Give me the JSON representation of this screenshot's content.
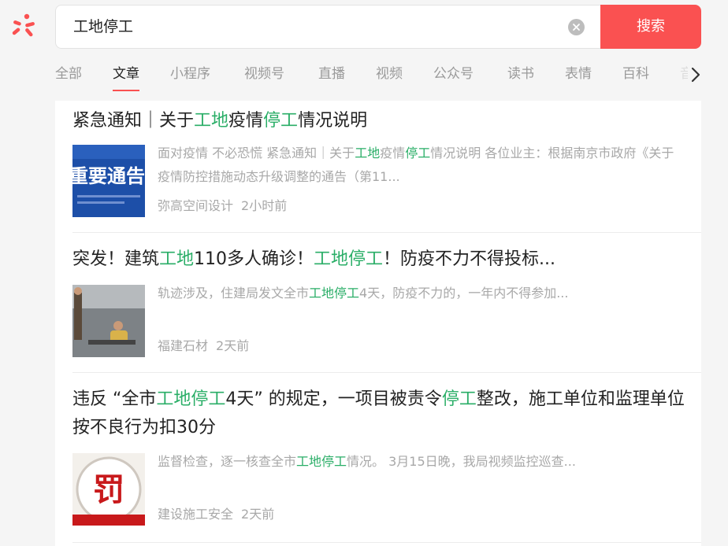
{
  "colors": {
    "accent": "#fa5151",
    "highlight": "#2aae67"
  },
  "search": {
    "query": "工地停工",
    "button_label": "搜索"
  },
  "tabs": [
    {
      "label": "全部",
      "active": false
    },
    {
      "label": "文章",
      "active": true
    },
    {
      "label": "小程序",
      "active": false
    },
    {
      "label": "视频号",
      "active": false
    },
    {
      "label": "直播",
      "active": false
    },
    {
      "label": "视频",
      "active": false
    },
    {
      "label": "公众号",
      "active": false
    },
    {
      "label": "读书",
      "active": false
    },
    {
      "label": "表情",
      "active": false
    },
    {
      "label": "百科",
      "active": false
    },
    {
      "label": "音",
      "active": false
    }
  ],
  "results": [
    {
      "title": [
        "紧急通知｜关于",
        {
          "hl": "工地"
        },
        "疫情",
        {
          "hl": "停工"
        },
        "情况说明"
      ],
      "snippet": [
        "面对疫情 不必恐慌 紧急通知｜关于",
        {
          "hl": "工地"
        },
        "疫情",
        {
          "hl": "停工"
        },
        "情况说明 各位业主：根据南京市政府《关于疫情防控措施动态升级调整的通告（第11..."
      ],
      "source": "弥高空间设计",
      "time": "2小时前",
      "thumb_text": "重要通告"
    },
    {
      "title": [
        "突发！建筑",
        {
          "hl": "工地"
        },
        "110多人确诊！",
        {
          "hl": "工地停工"
        },
        "！防疫不力不得投标..."
      ],
      "snippet": [
        "轨迹涉及，住建局发文全市",
        {
          "hl": "工地停工"
        },
        "4天，防疫不力的，一年内不得参加..."
      ],
      "source": "福建石材",
      "time": "2天前"
    },
    {
      "title": [
        "违反 “全市",
        {
          "hl": "工地停工"
        },
        "4天” 的规定，一项目被责令",
        {
          "hl": "停工"
        },
        "整改，施工单位和监理单位按不良行为扣30分"
      ],
      "snippet": [
        "监督检查，逐一核查全市",
        {
          "hl": "工地停工"
        },
        "情况。 3月15日晚，我局视频监控巡查..."
      ],
      "source": "建设施工安全",
      "time": "2天前",
      "thumb_text": "罚"
    }
  ]
}
